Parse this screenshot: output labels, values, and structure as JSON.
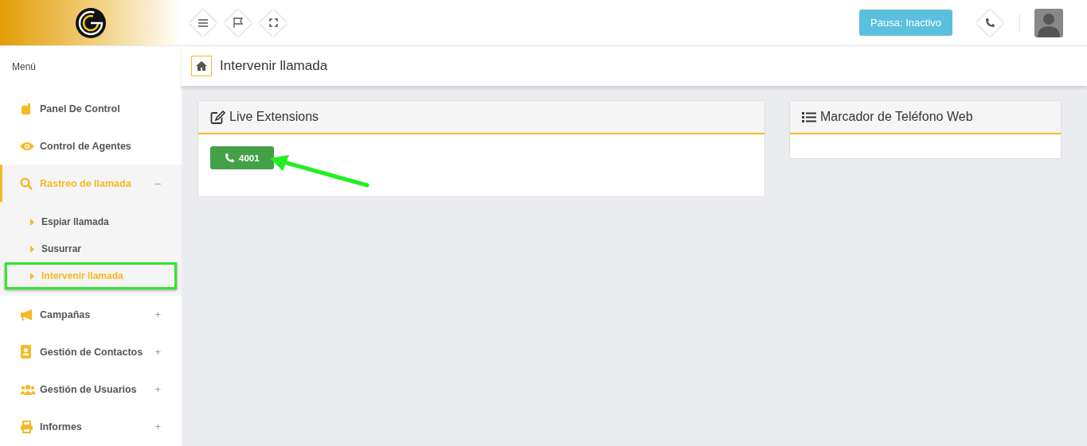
{
  "topbar": {
    "status_button": "Pausa: Inactivo"
  },
  "sidebar": {
    "heading": "Menú",
    "items": [
      {
        "label": "Panel De Control",
        "kind": "panel",
        "expanded": false
      },
      {
        "label": "Control de Agentes",
        "kind": "eye",
        "expanded": false
      },
      {
        "label": "Rastreo de llamada",
        "kind": "search",
        "expanded": true,
        "toggle": "–",
        "children": [
          {
            "label": "Espiar llamada",
            "selected": false,
            "highlighted": false
          },
          {
            "label": "Susurrar",
            "selected": false,
            "highlighted": false
          },
          {
            "label": "Intervenir llamada",
            "selected": true,
            "highlighted": true
          }
        ]
      },
      {
        "label": "Campañas",
        "kind": "megaphone",
        "expanded": false,
        "toggle": "+"
      },
      {
        "label": "Gestión de Contactos",
        "kind": "contact",
        "expanded": false,
        "toggle": "+"
      },
      {
        "label": "Gestión de Usuarios",
        "kind": "users",
        "expanded": false,
        "toggle": "+"
      },
      {
        "label": "Informes",
        "kind": "printer",
        "expanded": false,
        "toggle": "+"
      }
    ]
  },
  "page": {
    "title": "Intervenir llamada"
  },
  "panels": [
    {
      "title": "Live Extensions",
      "kind": "edit",
      "extensions": [
        "4001"
      ],
      "arrow": true
    },
    {
      "title": "Marcador de Teléfono Web",
      "kind": "list",
      "arrow": false
    }
  ]
}
